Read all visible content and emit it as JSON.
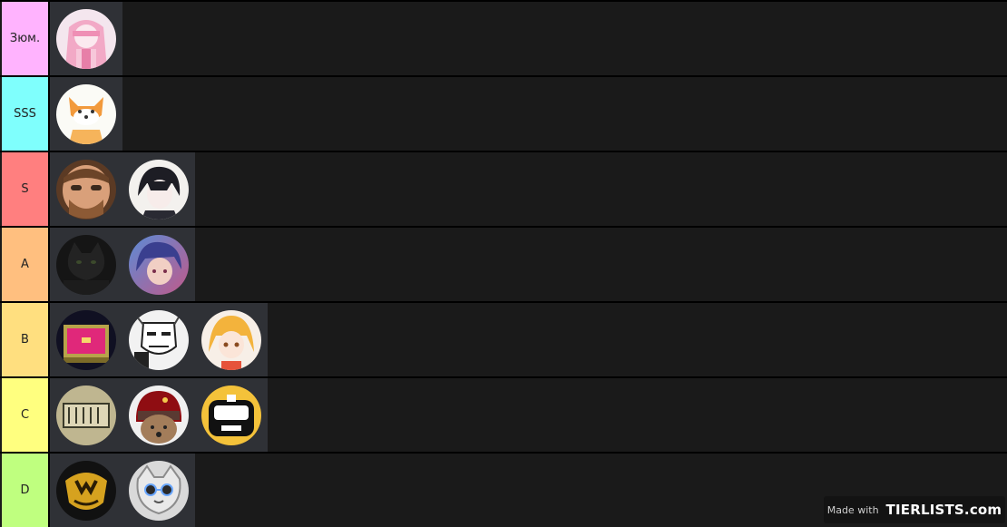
{
  "tiers": [
    {
      "label": "Зюм.",
      "color": "#ffb3fe",
      "items": [
        "anime-pink-girl-avatar"
      ]
    },
    {
      "label": "SSS",
      "color": "#7ffffd",
      "items": [
        "fox-cartoon-avatar"
      ]
    },
    {
      "label": "S",
      "color": "#ff7f7f",
      "items": [
        "bearded-man-avatar",
        "anime-boy-avatar"
      ]
    },
    {
      "label": "A",
      "color": "#ffbf7f",
      "items": [
        "black-cat-avatar",
        "blue-hair-girl-avatar"
      ]
    },
    {
      "label": "B",
      "color": "#ffdf7f",
      "items": [
        "pixel-chest-avatar",
        "manga-man-avatar",
        "blonde-anime-girl-avatar"
      ]
    },
    {
      "label": "C",
      "color": "#ffff7f",
      "items": [
        "accordion-avatar",
        "dog-ushanka-avatar",
        "visor-character-avatar"
      ]
    },
    {
      "label": "D",
      "color": "#bfff7f",
      "items": [
        "crash-mask-avatar",
        "cat-sunglasses-avatar"
      ]
    }
  ],
  "watermark": {
    "made_with": "Made with",
    "logo": "TIERLISTS.com"
  }
}
